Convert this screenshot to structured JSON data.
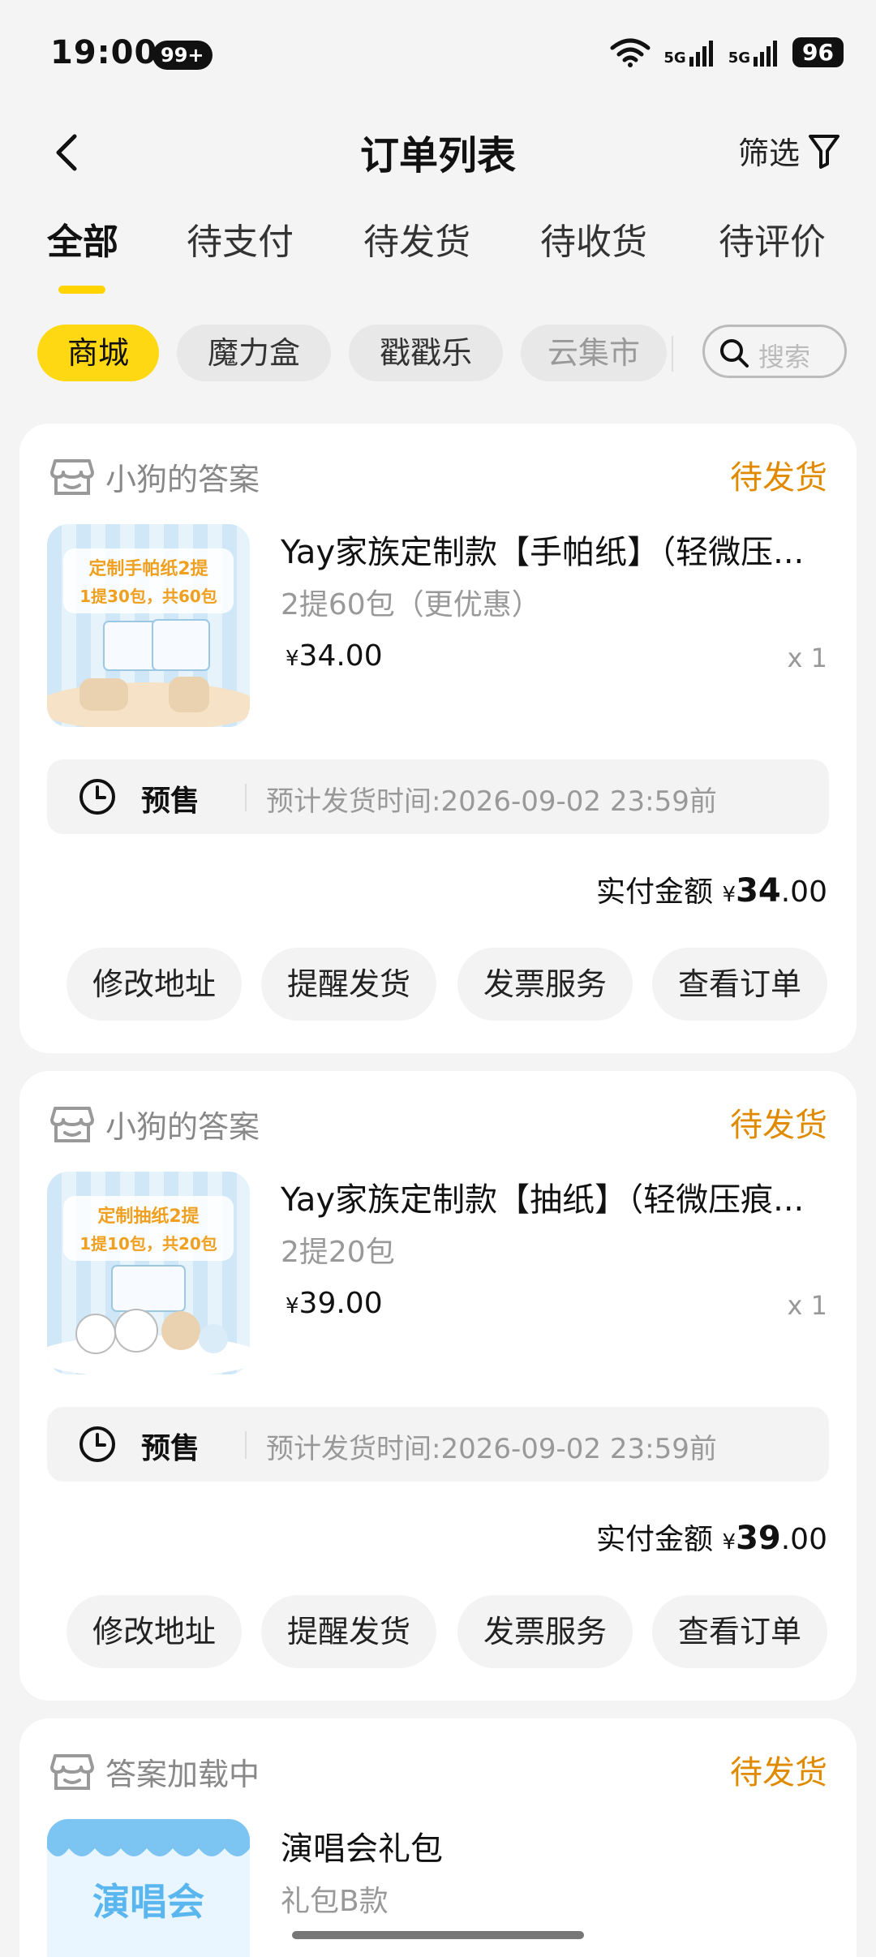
{
  "status_bar": {
    "time": "19:00",
    "notification_badge": "99+",
    "network_1": "5G",
    "network_2": "5G",
    "battery": "96"
  },
  "header": {
    "title": "订单列表",
    "filter_label": "筛选"
  },
  "tabs": [
    {
      "label": "全部",
      "active": true
    },
    {
      "label": "待支付"
    },
    {
      "label": "待发货"
    },
    {
      "label": "待收货"
    },
    {
      "label": "待评价"
    }
  ],
  "chips": [
    {
      "label": "商城",
      "active": true
    },
    {
      "label": "魔力盒"
    },
    {
      "label": "戳戳乐"
    },
    {
      "label": "云集市"
    }
  ],
  "search": {
    "placeholder": "搜索"
  },
  "colors": {
    "accent": "#ffd814",
    "status": "#e08a00"
  },
  "orders": [
    {
      "shop": "小狗的答案",
      "status": "待发货",
      "thumb_title": "定制手帕纸2提",
      "thumb_sub": "1提30包，共60包",
      "title": "Yay家族定制款【手帕纸】（轻微压...",
      "spec": "2提60包（更优惠）",
      "currency": "¥",
      "price": "34.00",
      "qty": "x 1",
      "presale_label": "预售",
      "presale_time": "预计发货时间:2026-09-02 23:59前",
      "paid_label": "实付金额",
      "paid_currency": "¥",
      "paid_int": "34",
      "paid_dec": ".00",
      "actions": [
        "修改地址",
        "提醒发货",
        "发票服务",
        "查看订单"
      ]
    },
    {
      "shop": "小狗的答案",
      "status": "待发货",
      "thumb_title": "定制抽纸2提",
      "thumb_sub": "1提10包，共20包",
      "title": "Yay家族定制款【抽纸】（轻微压痕...",
      "spec": "2提20包",
      "currency": "¥",
      "price": "39.00",
      "qty": "x 1",
      "presale_label": "预售",
      "presale_time": "预计发货时间:2026-09-02 23:59前",
      "paid_label": "实付金额",
      "paid_currency": "¥",
      "paid_int": "39",
      "paid_dec": ".00",
      "actions": [
        "修改地址",
        "提醒发货",
        "发票服务",
        "查看订单"
      ]
    },
    {
      "shop": "答案加载中",
      "status": "待发货",
      "thumb_title": "演唱会",
      "title": "演唱会礼包",
      "spec": "礼包B款"
    }
  ]
}
